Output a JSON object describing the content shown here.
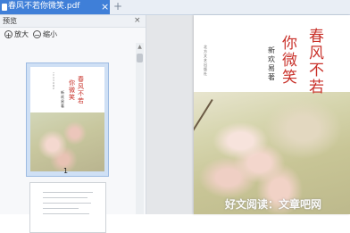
{
  "tab": {
    "title": "春风不若你微笑.pdf",
    "close": "×"
  },
  "new_tab": "+",
  "sidebar": {
    "title": "预览",
    "close": "×",
    "zoom_in_label": "放大",
    "zoom_in_symbol": "+",
    "zoom_out_label": "缩小",
    "zoom_out_symbol": "−",
    "scroll_up": "▲",
    "thumbnail": {
      "title_line1": "春风不若",
      "title_line2": "你微笑",
      "author": "新欢 易著",
      "publisher": "北方文艺出版社"
    },
    "page_number": "1"
  },
  "document": {
    "title_line1": "春风不若",
    "title_line2": "你微笑",
    "author": "新欢 易著",
    "publisher": "北方文艺出版社"
  },
  "watermark": "好文阅读：文章吧网",
  "colors": {
    "tab_active": "#3f7fd8",
    "title_red": "#c9322b",
    "selection": "#cfe0f5"
  },
  "icons": [
    "pdf-icon",
    "close-icon",
    "plus-icon",
    "zoom-in-icon",
    "zoom-out-icon",
    "scroll-up-icon"
  ]
}
